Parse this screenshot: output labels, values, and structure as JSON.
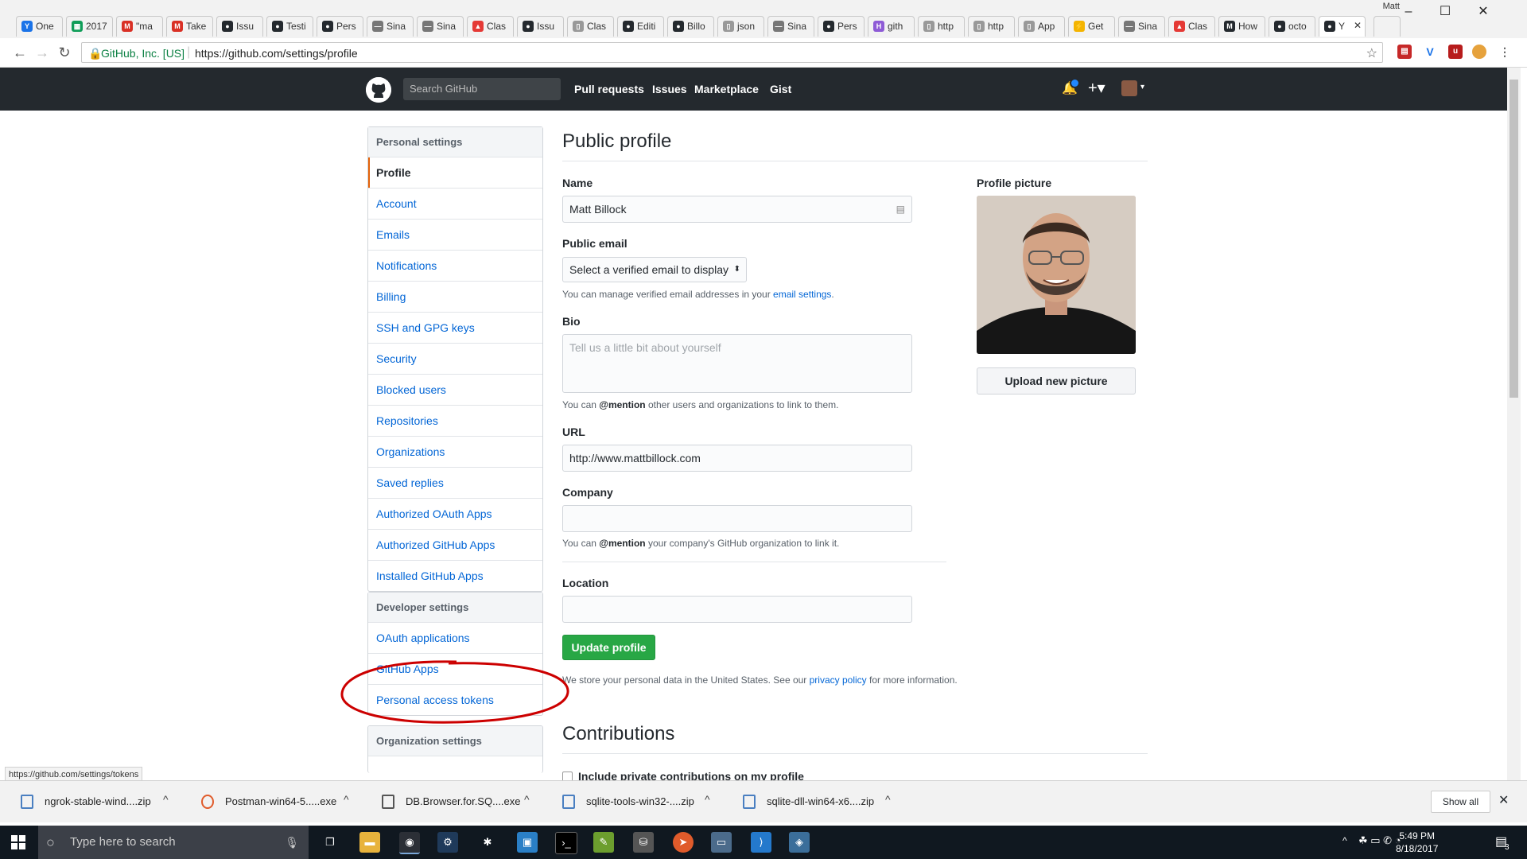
{
  "browser": {
    "tabs": [
      {
        "label": "One",
        "icon": "Y",
        "color": "#1a73e8"
      },
      {
        "label": "2017",
        "icon": "▦",
        "color": "#0f9d58"
      },
      {
        "label": "\"ma",
        "icon": "M",
        "color": "#d93025"
      },
      {
        "label": "Take",
        "icon": "M",
        "color": "#d93025"
      },
      {
        "label": "Issu",
        "icon": "●",
        "color": "#24292e"
      },
      {
        "label": "Testi",
        "icon": "●",
        "color": "#24292e"
      },
      {
        "label": "Pers",
        "icon": "●",
        "color": "#24292e"
      },
      {
        "label": "Sina",
        "icon": "—",
        "color": "#777777"
      },
      {
        "label": "Sina",
        "icon": "—",
        "color": "#777777"
      },
      {
        "label": "Clas",
        "icon": "▲",
        "color": "#e53935"
      },
      {
        "label": "Issu",
        "icon": "●",
        "color": "#24292e"
      },
      {
        "label": "Clas",
        "icon": "▯",
        "color": "#999999"
      },
      {
        "label": "Editi",
        "icon": "●",
        "color": "#24292e"
      },
      {
        "label": "Billo",
        "icon": "●",
        "color": "#24292e"
      },
      {
        "label": "json",
        "icon": "▯",
        "color": "#999999"
      },
      {
        "label": "Sina",
        "icon": "—",
        "color": "#777777"
      },
      {
        "label": "Pers",
        "icon": "●",
        "color": "#24292e"
      },
      {
        "label": "gith",
        "icon": "H",
        "color": "#8e5bd6"
      },
      {
        "label": "http",
        "icon": "▯",
        "color": "#999999"
      },
      {
        "label": "http",
        "icon": "▯",
        "color": "#999999"
      },
      {
        "label": "App",
        "icon": "▯",
        "color": "#999999"
      },
      {
        "label": "Get",
        "icon": "⚡",
        "color": "#f4b400"
      },
      {
        "label": "Sina",
        "icon": "—",
        "color": "#777777"
      },
      {
        "label": "Clas",
        "icon": "▲",
        "color": "#e53935"
      },
      {
        "label": "How",
        "icon": "M",
        "color": "#24292e"
      },
      {
        "label": "octo",
        "icon": "●",
        "color": "#24292e"
      },
      {
        "label": "Y",
        "icon": "●",
        "color": "#24292e"
      }
    ],
    "profile_name": "Matt",
    "secure_label": "GitHub, Inc. [US]",
    "url": "https://github.com/settings/profile"
  },
  "github": {
    "search_placeholder": "Search GitHub",
    "nav": [
      "Pull requests",
      "Issues",
      "Marketplace",
      "Gist"
    ]
  },
  "sidebar": {
    "personal_header": "Personal settings",
    "personal_items": [
      {
        "label": "Profile",
        "selected": true
      },
      {
        "label": "Account"
      },
      {
        "label": "Emails"
      },
      {
        "label": "Notifications"
      },
      {
        "label": "Billing"
      },
      {
        "label": "SSH and GPG keys"
      },
      {
        "label": "Security"
      },
      {
        "label": "Blocked users"
      },
      {
        "label": "Repositories"
      },
      {
        "label": "Organizations"
      },
      {
        "label": "Saved replies"
      },
      {
        "label": "Authorized OAuth Apps"
      },
      {
        "label": "Authorized GitHub Apps"
      },
      {
        "label": "Installed GitHub Apps"
      }
    ],
    "developer_header": "Developer settings",
    "developer_items": [
      {
        "label": "OAuth applications"
      },
      {
        "label": "GitHub Apps"
      },
      {
        "label": "Personal access tokens"
      }
    ],
    "org_header": "Organization settings"
  },
  "profile": {
    "title": "Public profile",
    "name_label": "Name",
    "name_value": "Matt Billock",
    "email_label": "Public email",
    "email_select": "Select a verified email to display",
    "email_note_pre": "You can manage verified email addresses in your ",
    "email_note_link": "email settings",
    "email_note_post": ".",
    "bio_label": "Bio",
    "bio_placeholder": "Tell us a little bit about yourself",
    "bio_note_pre": "You can ",
    "bio_note_bold": "@mention",
    "bio_note_post": " other users and organizations to link to them.",
    "url_label": "URL",
    "url_value": "http://www.mattbillock.com",
    "company_label": "Company",
    "company_note_pre": "You can ",
    "company_note_bold": "@mention",
    "company_note_post": " your company's GitHub organization to link it.",
    "location_label": "Location",
    "update_button": "Update profile",
    "privacy_pre": "We store your personal data in the United States. See our ",
    "privacy_link": "privacy policy",
    "privacy_post": " for more information.",
    "picture_label": "Profile picture",
    "upload_button": "Upload new picture",
    "contributions_title": "Contributions",
    "private_contrib_label": "Include private contributions on my profile"
  },
  "status_url": "https://github.com/settings/tokens",
  "downloads": {
    "items": [
      {
        "name": "ngrok-stable-wind....zip",
        "icon": "zip"
      },
      {
        "name": "Postman-win64-5.....exe",
        "icon": "postman"
      },
      {
        "name": "DB.Browser.for.SQ....exe",
        "icon": "db"
      },
      {
        "name": "sqlite-tools-win32-....zip",
        "icon": "zip"
      },
      {
        "name": "sqlite-dll-win64-x6....zip",
        "icon": "zip"
      }
    ],
    "show_all": "Show all"
  },
  "taskbar": {
    "search_placeholder": "Type here to search",
    "time": "5:49 PM",
    "date": "8/18/2017",
    "notification_count": "3"
  },
  "colors": {
    "github_header": "#24292e",
    "link": "#0366d6",
    "primary_button": "#28a745",
    "selected_accent": "#e36209",
    "annotation": "#cc0000"
  }
}
